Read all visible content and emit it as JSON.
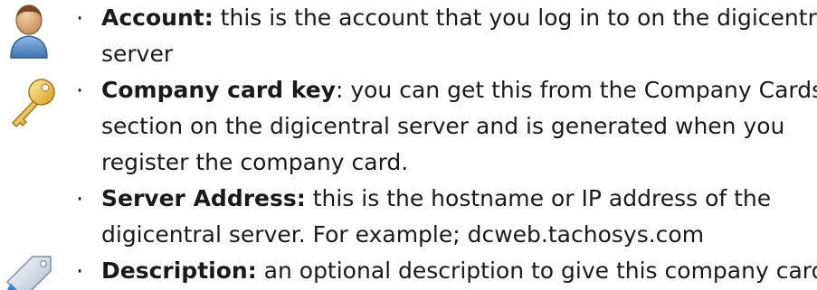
{
  "items": [
    {
      "icon": "user-icon",
      "term": "Account:",
      "lines": [
        "this is the account that you log in to on the digicentral",
        "server"
      ]
    },
    {
      "icon": "key-icon",
      "term": "Company card key",
      "lines": [
        ": you can get this from the Company Cards",
        "section on the digicentral server and is generated when you",
        "register the company card."
      ]
    },
    {
      "icon": "",
      "term": "Server Address:",
      "lines": [
        "this is the hostname or IP address of the",
        "digicentral server. For example; dcweb.tachosys.com"
      ]
    },
    {
      "icon": "tag-icon",
      "term": "Description:",
      "lines": [
        "an optional description to give this company card."
      ]
    }
  ],
  "bullet": "·",
  "colors": {
    "user_head": "#c9915e",
    "user_body": "#4a86c8",
    "key": "#e8b830",
    "tag": "#9fb2c8"
  }
}
